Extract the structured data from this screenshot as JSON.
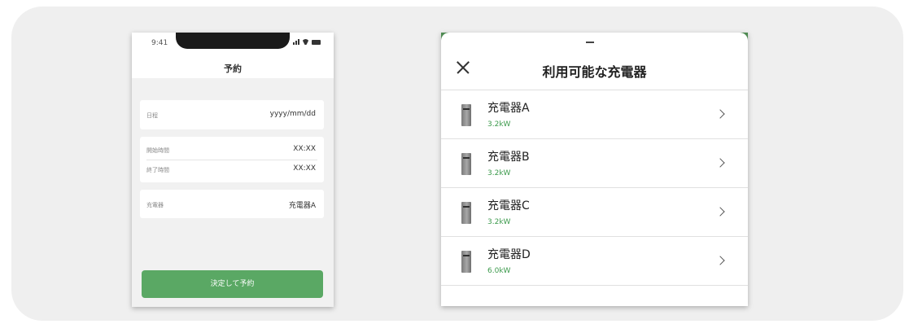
{
  "reservation_screen": {
    "status_time": "9:41",
    "title": "予約",
    "date_label": "日程",
    "date_value": "yyyy/mm/dd",
    "start_label": "開始時間",
    "start_value": "XX:XX",
    "end_label": "終了時間",
    "end_value": "XX:XX",
    "charger_label": "充電器",
    "charger_value": "充電器A",
    "submit_label": "決定して予約"
  },
  "charger_sheet": {
    "title": "利用可能な充電器",
    "items": [
      {
        "name": "充電器A",
        "power": "3.2kW"
      },
      {
        "name": "充電器B",
        "power": "3.2kW"
      },
      {
        "name": "充電器C",
        "power": "3.2kW"
      },
      {
        "name": "充電器D",
        "power": "6.0kW"
      }
    ]
  },
  "colors": {
    "accent_green": "#5aa864",
    "power_text_green": "#3c9a4c",
    "background": "#efefef"
  }
}
